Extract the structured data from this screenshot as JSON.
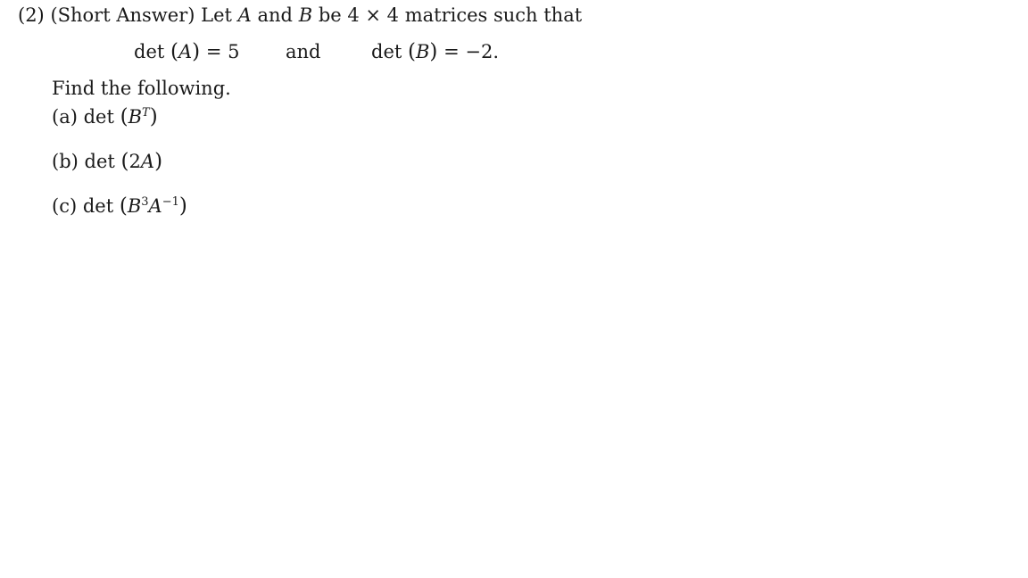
{
  "problem": {
    "number": "(2)",
    "type": "(Short Answer)",
    "intro_1": "Let",
    "var_a": "A",
    "intro_and": "and",
    "var_b": "B",
    "intro_2": "be 4 × 4 matrices such that",
    "given": {
      "left": {
        "func": "det",
        "arg": "A",
        "rhs": "= 5"
      },
      "connector": "and",
      "right": {
        "func": "det",
        "arg": "B",
        "rhs": "= −2."
      }
    },
    "prompt": "Find the following.",
    "parts": [
      {
        "label": "(a)",
        "func": "det",
        "base": "B",
        "sup": "T",
        "base2": "",
        "sup2": ""
      },
      {
        "label": "(b)",
        "func": "det",
        "base": "2",
        "var": "A"
      },
      {
        "label": "(c)",
        "func": "det",
        "base": "B",
        "sup": "3",
        "base2": "A",
        "sup2": "−1"
      }
    ]
  }
}
